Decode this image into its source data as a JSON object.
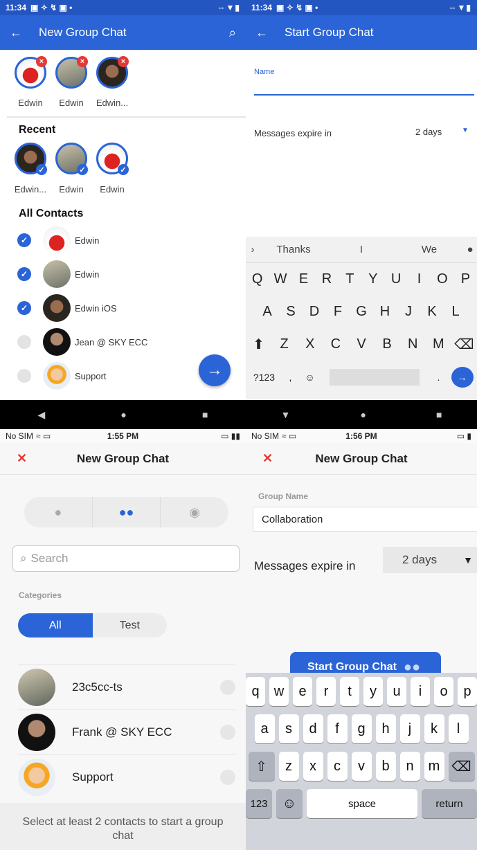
{
  "q1": {
    "status": {
      "time": "11:34",
      "right": "⇔▼▮"
    },
    "title": "New Group Chat",
    "selected": [
      {
        "label": "Edwin"
      },
      {
        "label": "Edwin"
      },
      {
        "label": "Edwin..."
      }
    ],
    "recent_title": "Recent",
    "recent": [
      {
        "label": "Edwin..."
      },
      {
        "label": "Edwin"
      },
      {
        "label": "Edwin"
      }
    ],
    "contacts_title": "All Contacts",
    "contacts": [
      {
        "name": "Edwin",
        "checked": true
      },
      {
        "name": "Edwin",
        "checked": true
      },
      {
        "name": "Edwin iOS",
        "checked": true
      },
      {
        "name": "Jean @ SKY ECC",
        "checked": false
      },
      {
        "name": "Support",
        "checked": false
      }
    ]
  },
  "q2": {
    "status": {
      "time": "11:34",
      "right": "⇔▼▮"
    },
    "title": "Start Group Chat",
    "name_label": "Name",
    "expire_label": "Messages expire in",
    "expire_value": "2 days",
    "suggestions": [
      "Thanks",
      "I",
      "We"
    ],
    "row1": [
      "Q",
      "W",
      "E",
      "R",
      "T",
      "Y",
      "U",
      "I",
      "O",
      "P"
    ],
    "row2": [
      "A",
      "S",
      "D",
      "F",
      "G",
      "H",
      "J",
      "K",
      "L"
    ],
    "row3": [
      "Z",
      "X",
      "C",
      "V",
      "B",
      "N",
      "M"
    ],
    "sym": "?123"
  },
  "q3": {
    "status": {
      "carrier": "No SIM",
      "time": "1:55 PM"
    },
    "title": "New Group Chat",
    "search_placeholder": "Search",
    "categories_label": "Categories",
    "cat_all": "All",
    "cat_test": "Test",
    "items": [
      {
        "name": "23c5cc-ts"
      },
      {
        "name": "Frank @ SKY ECC"
      },
      {
        "name": "Support"
      }
    ],
    "footer": "Select at least 2 contacts to start a group chat"
  },
  "q4": {
    "status": {
      "carrier": "No SIM",
      "time": "1:56 PM"
    },
    "title": "New Group Chat",
    "group_name_label": "Group Name",
    "group_name_value": "Collaboration",
    "expire_label": "Messages expire in",
    "expire_value": "2 days",
    "start_button": "Start Group Chat",
    "row1": [
      "q",
      "w",
      "e",
      "r",
      "t",
      "y",
      "u",
      "i",
      "o",
      "p"
    ],
    "row2": [
      "a",
      "s",
      "d",
      "f",
      "g",
      "h",
      "j",
      "k",
      "l"
    ],
    "row3": [
      "z",
      "x",
      "c",
      "v",
      "b",
      "n",
      "m"
    ],
    "num": "123",
    "space": "space",
    "return": "return"
  }
}
